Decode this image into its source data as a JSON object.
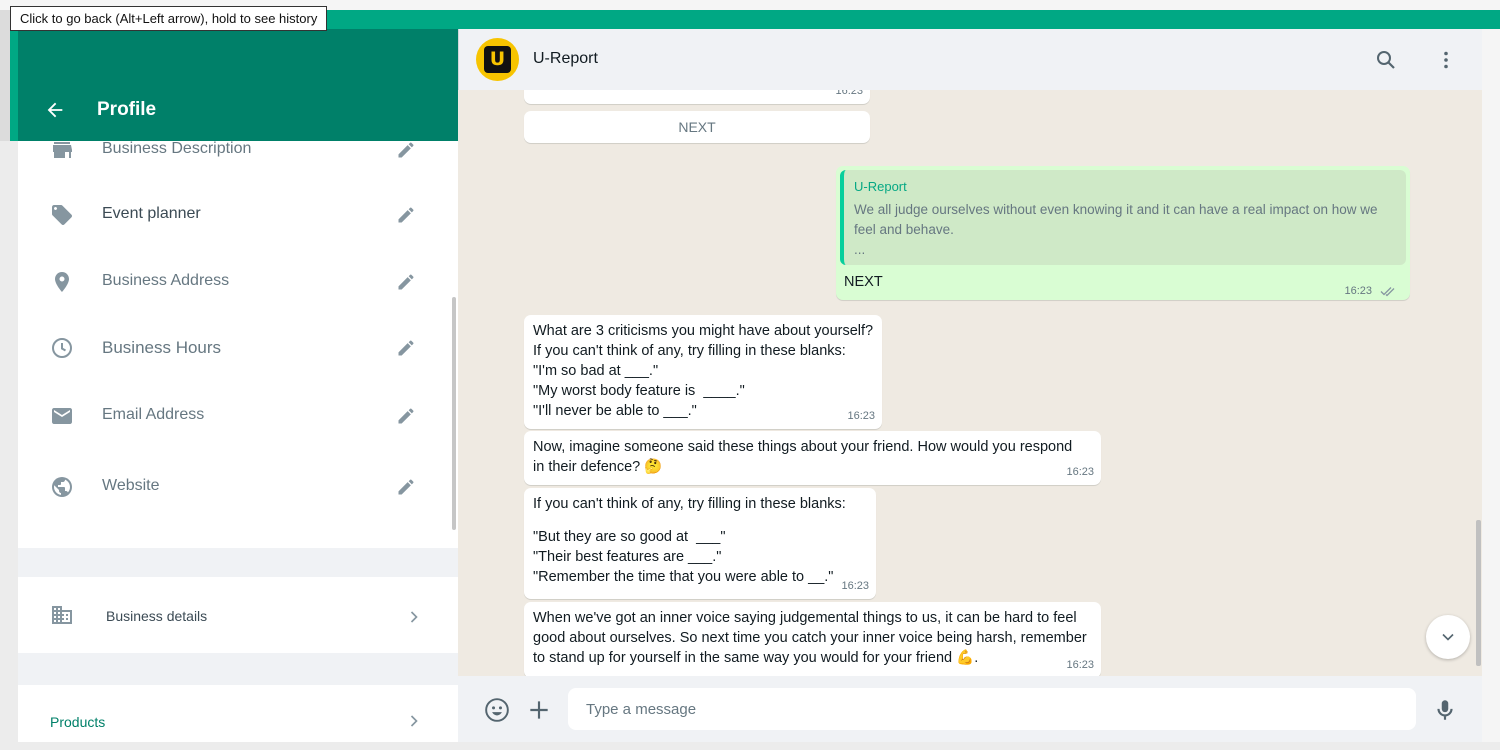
{
  "tooltip": "Click to go back (Alt+Left arrow), hold to see history",
  "profile": {
    "title": "Profile",
    "fields": [
      {
        "label": "Business Description",
        "icon": "store-icon"
      },
      {
        "label": "Event planner",
        "icon": "tag-icon"
      },
      {
        "label": "Business Address",
        "icon": "location-pin-icon"
      },
      {
        "label": "Business Hours",
        "icon": "clock-icon"
      },
      {
        "label": "Email Address",
        "icon": "email-icon"
      },
      {
        "label": "Website",
        "icon": "globe-icon"
      }
    ],
    "business_details": "Business details",
    "products": "Products"
  },
  "chat": {
    "contact_name": "U-Report",
    "avatar_letter": "U",
    "messages": {
      "m0_time": "16:23",
      "next_button": "NEXT",
      "outgoing": {
        "quote_author": "U-Report",
        "quote_text": "We all judge ourselves without even knowing it and it can have a real impact on how we feel and behave.",
        "quote_ellipsis": "...",
        "text": "NEXT",
        "time": "16:23"
      },
      "m1": {
        "lines": [
          "What are 3 criticisms you might have about yourself?",
          "If you can't think of any, try filling in these blanks:",
          "\"I'm so bad at ___.\"",
          "\"My worst body feature is  ____.\"",
          "\"I'll never be able to ___.\""
        ],
        "time": "16:23"
      },
      "m2": {
        "lines": [
          "Now, imagine someone said these things about your friend. How would you respond",
          "in their defence? 🤔"
        ],
        "time": "16:23"
      },
      "m3": {
        "lines": [
          "If you can't think of any, try filling in these blanks:",
          "",
          "\"But they are so good at  ___\"",
          "\"Their best features are ___.\"",
          "\"Remember the time that you were able to __.\""
        ],
        "time": "16:23"
      },
      "m4": {
        "lines": [
          "When we've got an inner voice saying judgemental things to us, it can be hard to feel",
          "good about ourselves. So next time you catch your inner voice being harsh, remember",
          "to stand up for yourself in the same way you would for your friend 💪."
        ],
        "time": "16:23"
      }
    },
    "input_placeholder": "Type a message"
  },
  "colors": {
    "accent": "#00a884",
    "header_dark": "#008069",
    "outgoing_bubble": "#d9fdd3",
    "chat_bg": "#efeae2"
  }
}
